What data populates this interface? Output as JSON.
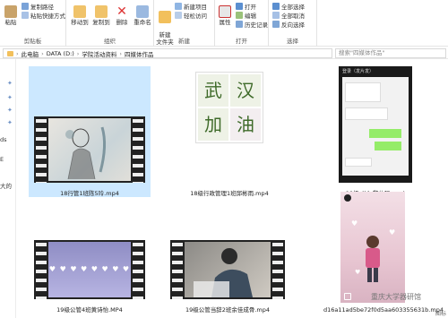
{
  "ribbon": {
    "clipboard": {
      "label": "剪贴板",
      "paste": "粘贴",
      "copy_path": "复制路径",
      "paste_shortcut": "粘贴快捷方式"
    },
    "organize": {
      "label": "组织",
      "move_to": "移动到",
      "copy_to": "复制到",
      "delete": "删除",
      "rename": "重命名"
    },
    "new": {
      "label": "新建",
      "new_folder": "新建\n文件夹",
      "new_item": "新建项目",
      "easy_access": "轻松访问"
    },
    "open": {
      "label": "打开",
      "properties": "属性",
      "open": "打开",
      "edit": "编辑",
      "history": "历史记录"
    },
    "select": {
      "label": "选择",
      "select_all": "全部选择",
      "select_none": "全部取消",
      "invert": "反向选择"
    }
  },
  "address": {
    "path": [
      "此电脑",
      "DATA (D:)",
      "学院活动资料",
      "四媒体作品"
    ],
    "search_placeholder": "搜索\"四媒体作品\""
  },
  "nav": {
    "fragments": [
      "ds",
      "E",
      "大的"
    ]
  },
  "files": [
    {
      "name": "18行管1班陈5玲.mp4",
      "selected": true
    },
    {
      "name": "18级行政管理1班邱彬雨.mp4",
      "selected": false
    },
    {
      "name": "19级-公1-黎依玩.mp4",
      "selected": false
    },
    {
      "name": "19级公管4班黄诗怡.MP4",
      "selected": false
    },
    {
      "name": "19级公管当辞2班余佳成骨.mp4",
      "selected": false
    },
    {
      "name": "d16a11ad5be72f0d5aa603355631b.mp4",
      "selected": false
    }
  ],
  "thumbs": {
    "calligraphy": [
      "武",
      "汉",
      "加",
      "油"
    ],
    "chat_header": "登录（发片发）",
    "hearts": "♥ ♥ ♥ ♥ ♥ ♥ ♥ ♥",
    "watermark": "重庆大学器研馆"
  },
  "status": "图标"
}
